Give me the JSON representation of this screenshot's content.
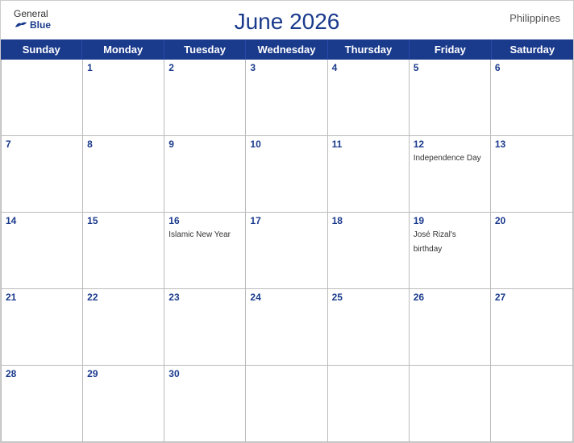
{
  "header": {
    "title": "June 2026",
    "country": "Philippines",
    "logo_general": "General",
    "logo_blue": "Blue"
  },
  "days_of_week": [
    "Sunday",
    "Monday",
    "Tuesday",
    "Wednesday",
    "Thursday",
    "Friday",
    "Saturday"
  ],
  "weeks": [
    [
      {
        "num": "",
        "event": ""
      },
      {
        "num": "1",
        "event": ""
      },
      {
        "num": "2",
        "event": ""
      },
      {
        "num": "3",
        "event": ""
      },
      {
        "num": "4",
        "event": ""
      },
      {
        "num": "5",
        "event": ""
      },
      {
        "num": "6",
        "event": ""
      }
    ],
    [
      {
        "num": "7",
        "event": ""
      },
      {
        "num": "8",
        "event": ""
      },
      {
        "num": "9",
        "event": ""
      },
      {
        "num": "10",
        "event": ""
      },
      {
        "num": "11",
        "event": ""
      },
      {
        "num": "12",
        "event": "Independence Day"
      },
      {
        "num": "13",
        "event": ""
      }
    ],
    [
      {
        "num": "14",
        "event": ""
      },
      {
        "num": "15",
        "event": ""
      },
      {
        "num": "16",
        "event": "Islamic New Year"
      },
      {
        "num": "17",
        "event": ""
      },
      {
        "num": "18",
        "event": ""
      },
      {
        "num": "19",
        "event": "José Rizal's birthday"
      },
      {
        "num": "20",
        "event": ""
      }
    ],
    [
      {
        "num": "21",
        "event": ""
      },
      {
        "num": "22",
        "event": ""
      },
      {
        "num": "23",
        "event": ""
      },
      {
        "num": "24",
        "event": ""
      },
      {
        "num": "25",
        "event": ""
      },
      {
        "num": "26",
        "event": ""
      },
      {
        "num": "27",
        "event": ""
      }
    ],
    [
      {
        "num": "28",
        "event": ""
      },
      {
        "num": "29",
        "event": ""
      },
      {
        "num": "30",
        "event": ""
      },
      {
        "num": "",
        "event": ""
      },
      {
        "num": "",
        "event": ""
      },
      {
        "num": "",
        "event": ""
      },
      {
        "num": "",
        "event": ""
      }
    ]
  ]
}
